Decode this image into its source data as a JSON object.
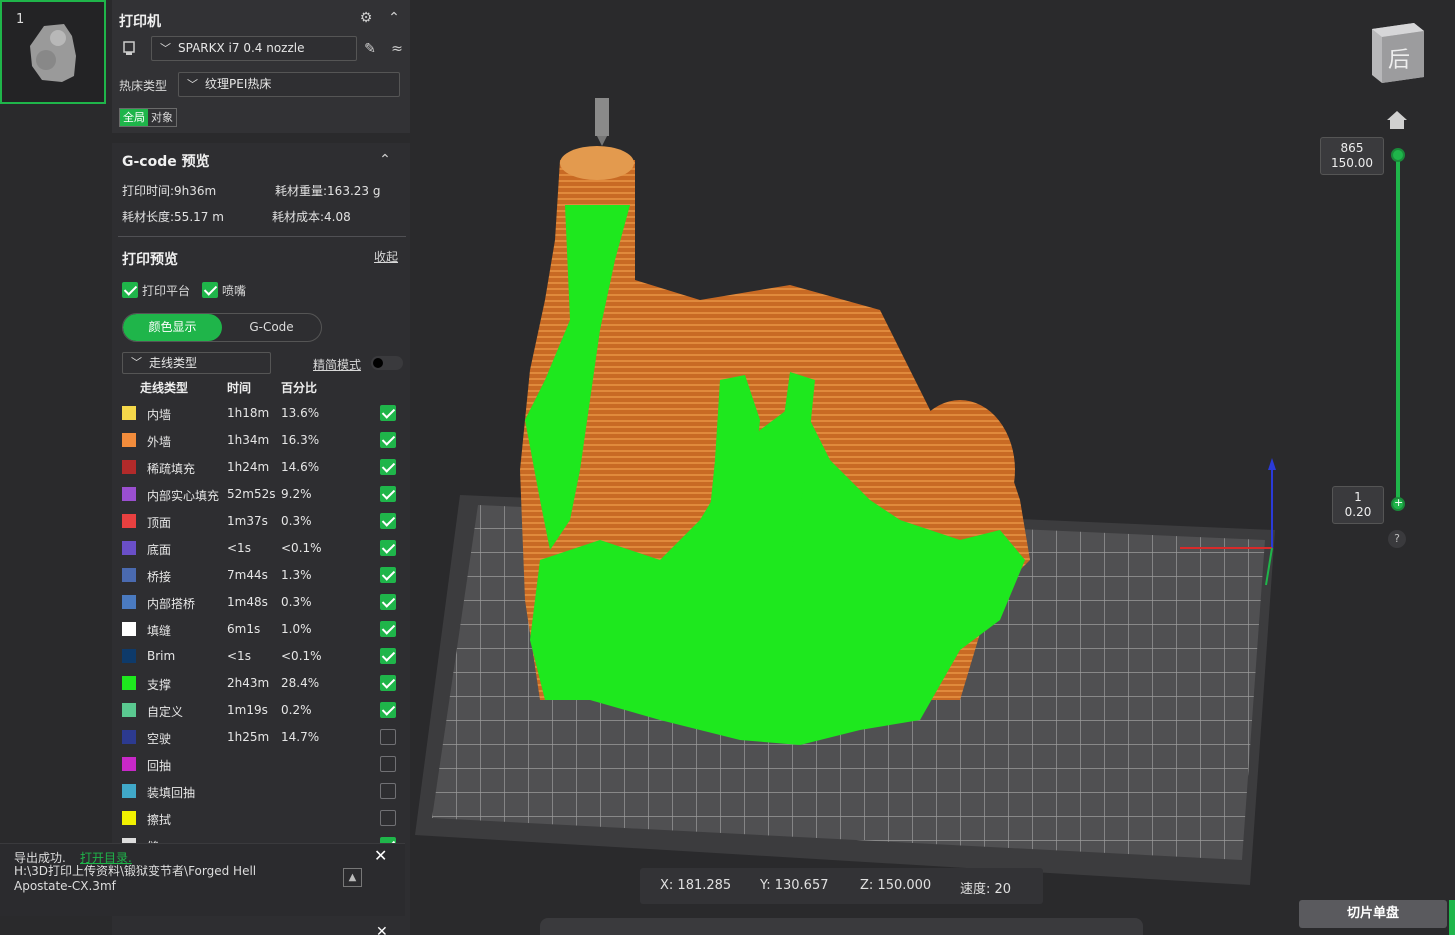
{
  "plate": {
    "number": "1"
  },
  "printer": {
    "title": "打印机",
    "printer_name": "SPARKX i7 0.4 nozzle",
    "bed_type_label": "热床类型",
    "bed_type_value": "纹理PEI热床",
    "scope_global": "全局",
    "scope_object": "对象"
  },
  "gcode_preview": {
    "title": "G-code 预览",
    "print_time": "打印时间:9h36m",
    "filament_weight": "耗材重量:163.23 g",
    "filament_length": "耗材长度:55.17 m",
    "filament_cost": "耗材成本:4.08"
  },
  "print_preview": {
    "title": "打印预览",
    "collapse_label": "收起",
    "show_plate_label": "打印平台",
    "show_nozzle_label": "喷嘴",
    "tab_color": "颜色显示",
    "tab_gcode": "G-Code",
    "view_type": "走线类型",
    "simple_mode_label": "精简模式",
    "columns": [
      "走线类型",
      "时间",
      "百分比"
    ],
    "rows": [
      {
        "name": "内墙",
        "time": "1h18m",
        "pct": "13.6%",
        "color": "#f5d84a",
        "checked": true
      },
      {
        "name": "外墙",
        "time": "1h34m",
        "pct": "16.3%",
        "color": "#f28c3c",
        "checked": true
      },
      {
        "name": "稀疏填充",
        "time": "1h24m",
        "pct": "14.6%",
        "color": "#b22a2a",
        "checked": true
      },
      {
        "name": "内部实心填充",
        "time": "52m52s",
        "pct": "9.2%",
        "color": "#9a4fd0",
        "checked": true
      },
      {
        "name": "顶面",
        "time": "1m37s",
        "pct": "0.3%",
        "color": "#e84040",
        "checked": true
      },
      {
        "name": "底面",
        "time": "<1s",
        "pct": "<0.1%",
        "color": "#6a4fc8",
        "checked": true
      },
      {
        "name": "桥接",
        "time": "7m44s",
        "pct": "1.3%",
        "color": "#4a6ab0",
        "checked": true
      },
      {
        "name": "内部搭桥",
        "time": "1m48s",
        "pct": "0.3%",
        "color": "#4a7ac0",
        "checked": true
      },
      {
        "name": "填缝",
        "time": "6m1s",
        "pct": "1.0%",
        "color": "#ffffff",
        "checked": true
      },
      {
        "name": "Brim",
        "time": "<1s",
        "pct": "<0.1%",
        "color": "#0e3a6a",
        "checked": true
      },
      {
        "name": "支撑",
        "time": "2h43m",
        "pct": "28.4%",
        "color": "#1ee81e",
        "checked": true
      },
      {
        "name": "自定义",
        "time": "1m19s",
        "pct": "0.2%",
        "color": "#5ac890",
        "checked": true
      },
      {
        "name": "空驶",
        "time": "1h25m",
        "pct": "14.7%",
        "color": "#2c3a90",
        "checked": false
      },
      {
        "name": "回抽",
        "time": "",
        "pct": "",
        "color": "#c828c8",
        "checked": false
      },
      {
        "name": "装填回抽",
        "time": "",
        "pct": "",
        "color": "#40a8c8",
        "checked": false
      },
      {
        "name": "擦拭",
        "time": "",
        "pct": "",
        "color": "#f0f000",
        "checked": false
      },
      {
        "name": "缝",
        "time": "",
        "pct": "",
        "color": "#dddddd",
        "checked": true
      }
    ]
  },
  "notification": {
    "text": "导出成功.",
    "link": "打开目录.",
    "path": "H:\\3D打印上传资料\\锻狱变节者\\Forged Hell Apostate-CX.3mf"
  },
  "layer_slider": {
    "top_layer": "865",
    "top_height": "150.00",
    "bottom_layer": "1",
    "bottom_height": "0.20",
    "help": "?"
  },
  "coords": {
    "x": "X: 181.285",
    "y": "Y: 130.657",
    "z": "Z: 150.000",
    "speed": "速度: 20"
  },
  "nav_cube_label": "后",
  "slice_button": "切片单盘",
  "colors": {
    "accent": "#1fb54a",
    "support": "#1ee81e",
    "wall": "#d4772c"
  }
}
